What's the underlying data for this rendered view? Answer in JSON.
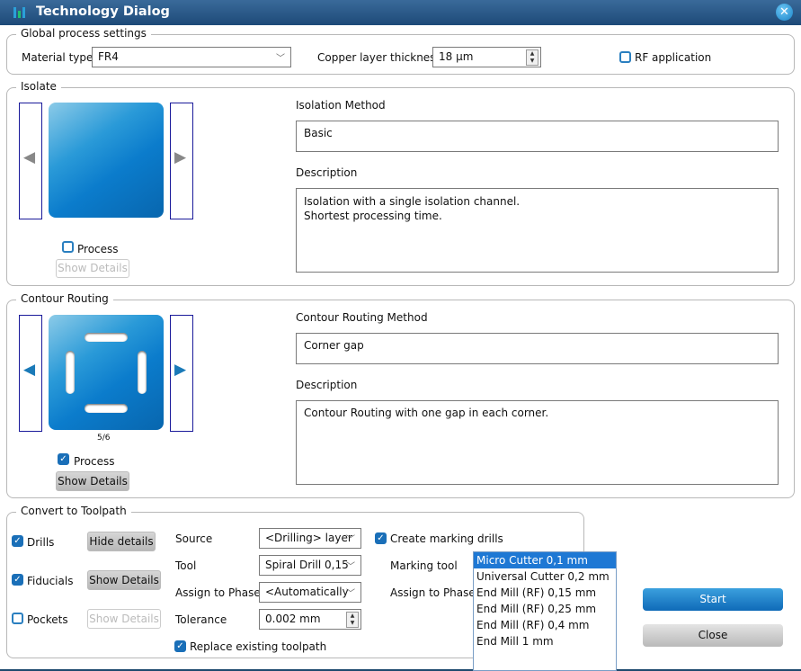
{
  "window": {
    "title": "Technology Dialog"
  },
  "global": {
    "legend": "Global process settings",
    "material_label": "Material type",
    "material_value": "FR4",
    "copper_label": "Copper layer thickness",
    "copper_value": "18 µm",
    "rf_label": "RF application",
    "rf_checked": false
  },
  "isolate": {
    "legend": "Isolate",
    "process_label": "Process",
    "process_checked": false,
    "show_details": "Show Details",
    "method_label": "Isolation Method",
    "method_value": "Basic",
    "description_label": "Description",
    "description_line1": "Isolation with a single isolation channel.",
    "description_line2": "Shortest processing time."
  },
  "contour": {
    "legend": "Contour Routing",
    "page": "5/6",
    "process_label": "Process",
    "process_checked": true,
    "show_details": "Show Details",
    "method_label": "Contour Routing Method",
    "method_value": "Corner gap",
    "description_label": "Description",
    "description_line1": "Contour Routing with one gap in each corner."
  },
  "toolpath": {
    "legend": "Convert to Toolpath",
    "drills_label": "Drills",
    "drills_btn": "Hide details",
    "fiducials_label": "Fiducials",
    "fiducials_btn": "Show Details",
    "pockets_label": "Pockets",
    "pockets_btn": "Show Details",
    "source_label": "Source",
    "source_value": "<Drilling>  layer",
    "tool_label": "Tool",
    "tool_value": "Spiral  Drill 0,15",
    "phase_label": "Assign to Phase",
    "phase_value": "<Automatically",
    "tolerance_label": "Tolerance",
    "tolerance_value": "0.002 mm",
    "replace_label": "Replace existing toolpath",
    "marking_drills_label": "Create marking drills",
    "marking_tool_label": "Marking tool",
    "marking_tool_value": "Universal Cutter",
    "marking_phase_label": "Assign to Phase",
    "marking_tool_options": [
      "Micro Cutter 0,1 mm",
      "Universal Cutter 0,2 mm",
      "End Mill (RF) 0,15 mm",
      "End Mill (RF) 0,25 mm",
      "End Mill (RF) 0,4 mm",
      "End Mill 1 mm"
    ]
  },
  "buttons": {
    "start": "Start",
    "close": "Close"
  }
}
